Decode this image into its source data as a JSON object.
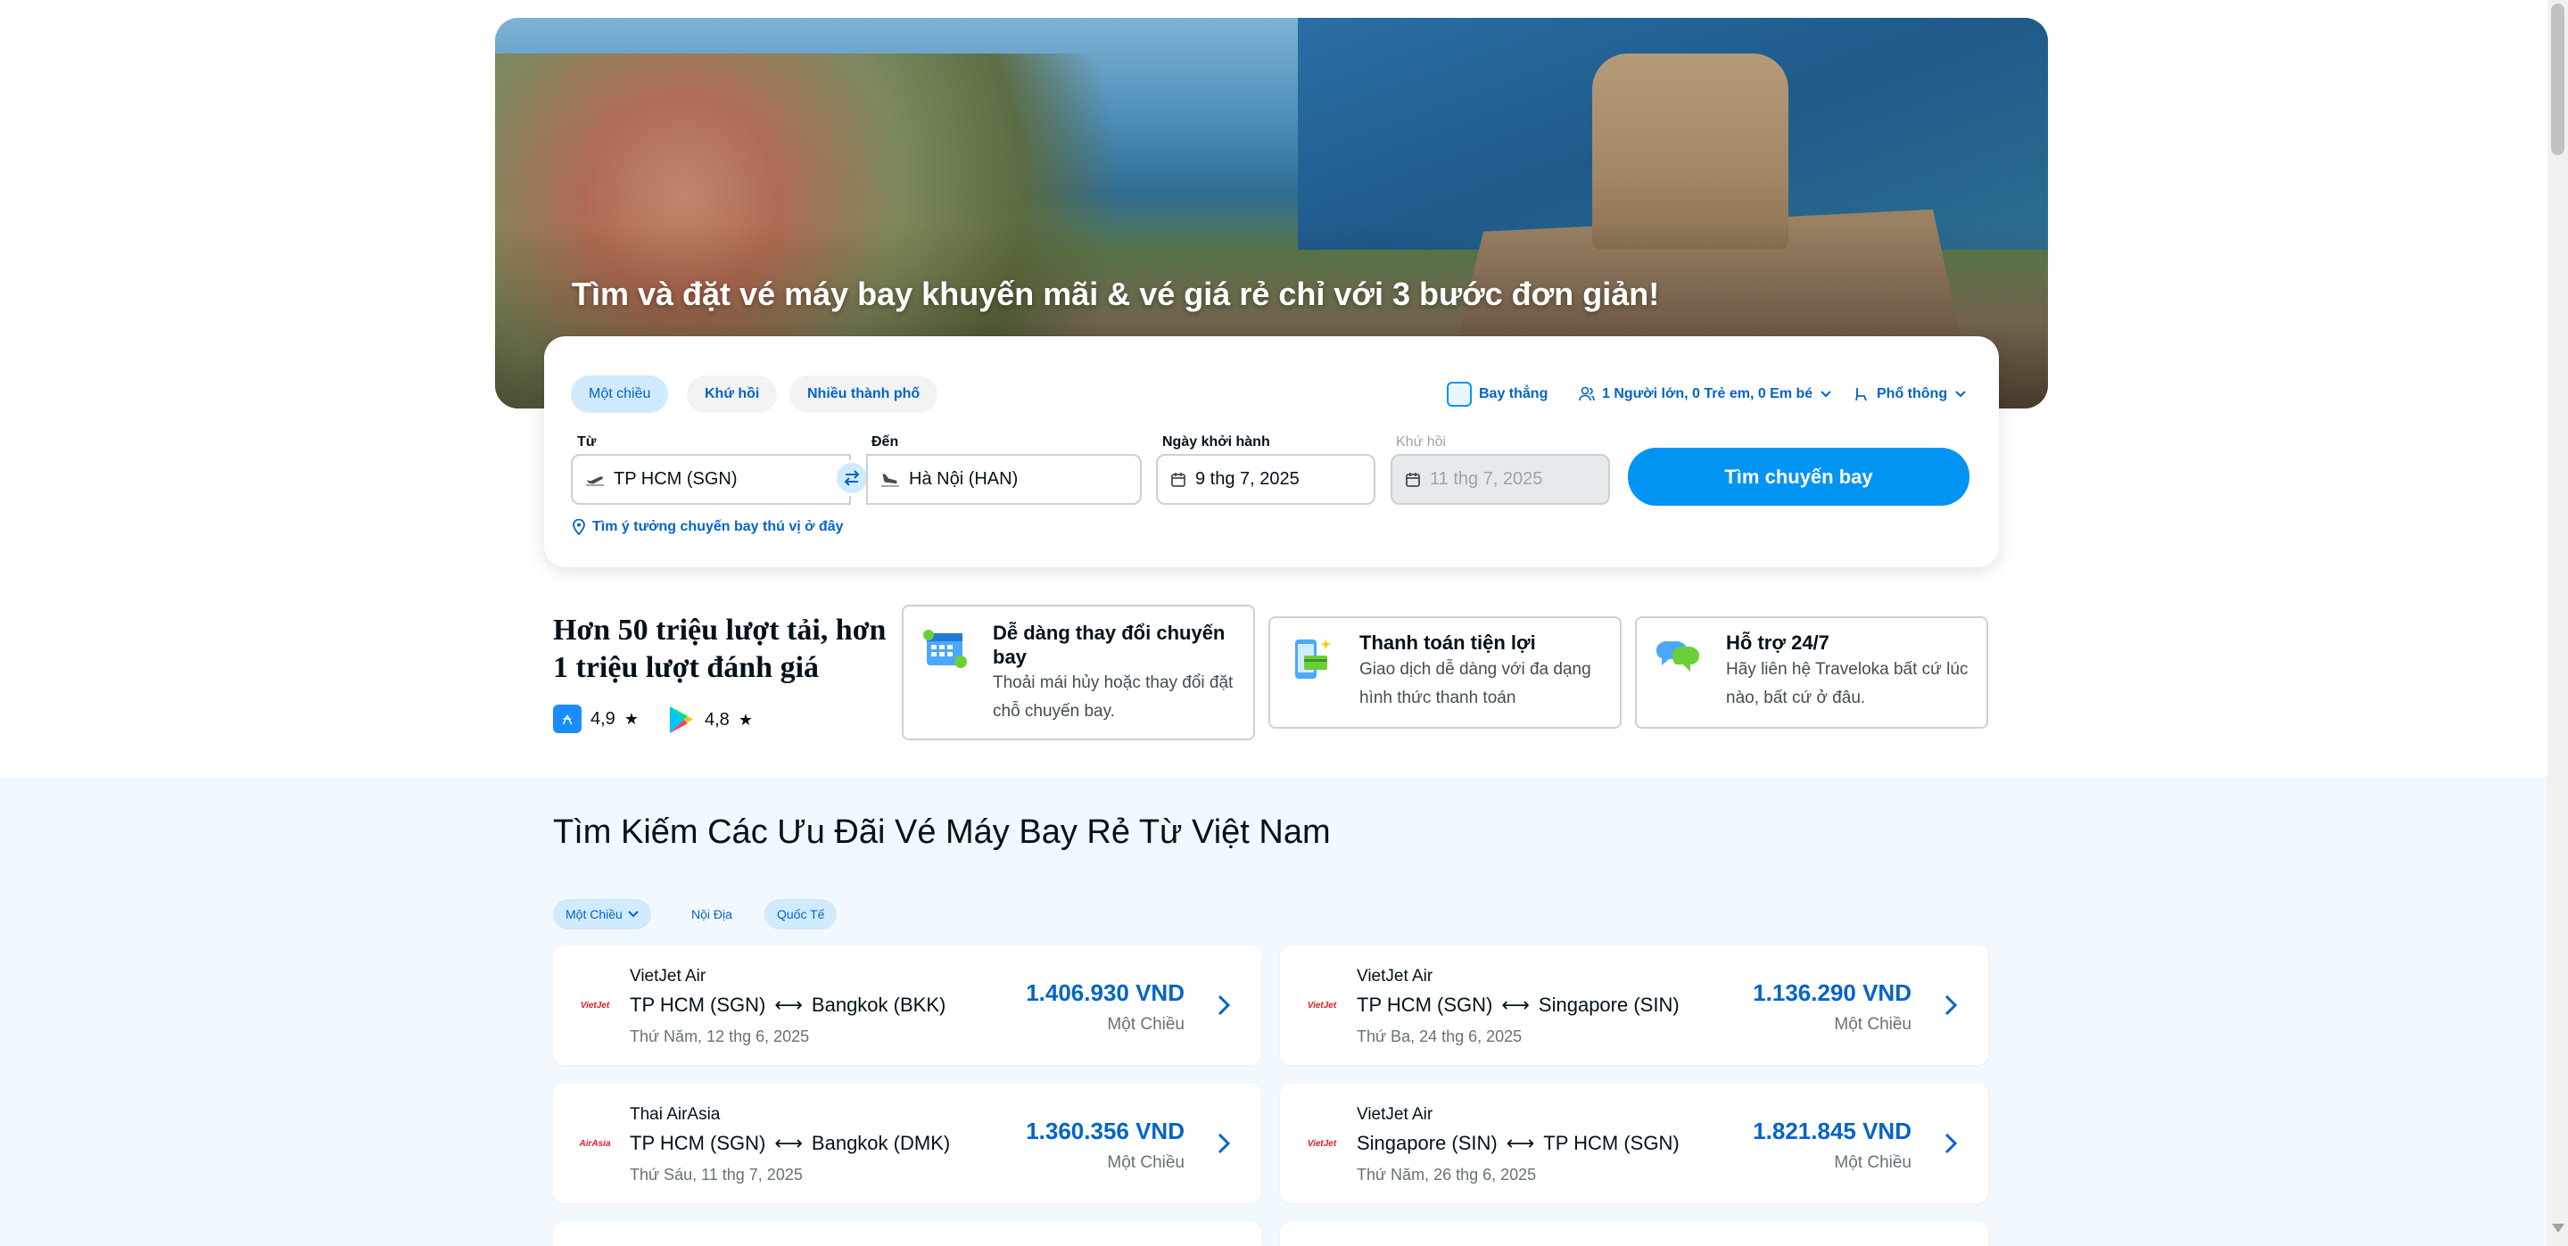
{
  "hero": {
    "title": "Tìm và đặt vé máy bay khuyến mãi & vé giá rẻ chỉ với 3 bước đơn giản!"
  },
  "search": {
    "trip_types": [
      "Một chiều",
      "Khứ hồi",
      "Nhiều thành phố"
    ],
    "direct_flight_label": "Bay thẳng",
    "passengers_label": "1 Người lớn, 0 Trẻ em, 0 Em bé",
    "cabin_class_label": "Phổ thông",
    "from_label": "Từ",
    "from_value": "TP HCM (SGN)",
    "to_label": "Đến",
    "to_value": "Hà Nội (HAN)",
    "depart_label": "Ngày khởi hành",
    "depart_value": "9 thg 7, 2025",
    "return_label": "Khứ hồi",
    "return_value": "11 thg 7, 2025",
    "search_button": "Tìm chuyến bay",
    "idea_link": "Tìm ý tưởng chuyến bay thú vị ở đây"
  },
  "stats": {
    "title": "Hơn 50 triệu lượt tải, hơn 1 triệu lượt đánh giá",
    "app_store_rating": "4,9",
    "play_store_rating": "4,8"
  },
  "features": [
    {
      "title": "Dễ dàng thay đổi chuyến bay",
      "desc": "Thoải mái hủy hoặc thay đổi đặt chỗ chuyến bay.",
      "icon": "calendar-icon"
    },
    {
      "title": "Thanh toán tiện lợi",
      "desc": "Giao dịch dễ dàng với đa dạng hình thức thanh toán",
      "icon": "payment-icon"
    },
    {
      "title": "Hỗ trợ 24/7",
      "desc": "Hãy liên hệ Traveloka bất cứ lúc nào, bất cứ ở đâu.",
      "icon": "chat-support-icon"
    }
  ],
  "deals": {
    "title": "Tìm Kiếm Các Ưu Đãi Vé Máy Bay Rẻ Từ Việt Nam",
    "chips": [
      "Một Chiều",
      "Nội Địa",
      "Quốc Tế"
    ],
    "items": [
      {
        "airline": "VietJet Air",
        "logo": "VietJet",
        "from": "TP HCM (SGN)",
        "to": "Bangkok (BKK)",
        "date": "Thứ Năm, 12 thg 6, 2025",
        "price": "1.406.930 VND",
        "type": "Một Chiều"
      },
      {
        "airline": "VietJet Air",
        "logo": "VietJet",
        "from": "TP HCM (SGN)",
        "to": "Singapore (SIN)",
        "date": "Thứ Ba, 24 thg 6, 2025",
        "price": "1.136.290 VND",
        "type": "Một Chiều"
      },
      {
        "airline": "Thai AirAsia",
        "logo": "AirAsia",
        "from": "TP HCM (SGN)",
        "to": "Bangkok (DMK)",
        "date": "Thứ Sáu, 11 thg 7, 2025",
        "price": "1.360.356 VND",
        "type": "Một Chiều"
      },
      {
        "airline": "VietJet Air",
        "logo": "VietJet",
        "from": "Singapore (SIN)",
        "to": "TP HCM (SGN)",
        "date": "Thứ Năm, 26 thg 6, 2025",
        "price": "1.821.845 VND",
        "type": "Một Chiều"
      }
    ]
  },
  "colors": {
    "primary": "#0194f3",
    "link": "#0264c8",
    "chip_bg": "#d0eaff",
    "section_bg": "#f1f8fe"
  }
}
